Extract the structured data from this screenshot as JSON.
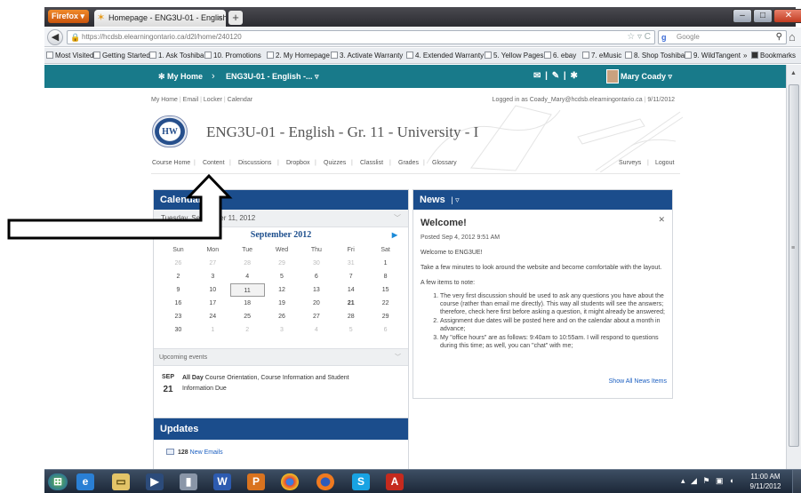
{
  "browser": {
    "firefox_button": "Firefox",
    "tab_title": "Homepage - ENG3U-01 - English - Gr. 11...",
    "url": "https://hcdsb.elearningontario.ca/d2l/home/240120",
    "search_placeholder": "Google"
  },
  "bookmarks": [
    "Most Visited",
    "Getting Started",
    "1. Ask Toshiba",
    "10. Promotions",
    "2. My Homepage",
    "3. Activate Warranty",
    "4. Extended Warranty",
    "5. Yellow Pages",
    "6. ebay",
    "7. eMusic",
    "8. Shop Toshiba",
    "9. WildTangent",
    "»",
    "Bookmarks"
  ],
  "d2l": {
    "my_home": "My Home",
    "course_crumb": "ENG3U-01 - English -...",
    "user": "Mary Coady"
  },
  "utility_nav": [
    "My Home",
    "Email",
    "Locker",
    "Calendar"
  ],
  "logged_in": "Logged in as Coady_Mary@hcdsb.elearningontario.ca",
  "date": "9/11/2012",
  "course_title": "ENG3U-01 - English - Gr. 11 - University - I",
  "logo_text": "HW",
  "course_nav": [
    "Course Home",
    "Content",
    "Discussions",
    "Dropbox",
    "Quizzes",
    "Classlist",
    "Grades",
    "Glossary"
  ],
  "course_nav_right": [
    "Surveys",
    "Logout"
  ],
  "calendar": {
    "title": "Calendar",
    "current_date": "Tuesday, September 11, 2012",
    "month": "September 2012",
    "weekdays": [
      "Sun",
      "Mon",
      "Tue",
      "Wed",
      "Thu",
      "Fri",
      "Sat"
    ],
    "weeks": [
      [
        "26",
        "27",
        "28",
        "29",
        "30",
        "31",
        "1"
      ],
      [
        "2",
        "3",
        "4",
        "5",
        "6",
        "7",
        "8"
      ],
      [
        "9",
        "10",
        "11",
        "12",
        "13",
        "14",
        "15"
      ],
      [
        "16",
        "17",
        "18",
        "19",
        "20",
        "21",
        "22"
      ],
      [
        "23",
        "24",
        "25",
        "26",
        "27",
        "28",
        "29"
      ],
      [
        "30",
        "1",
        "2",
        "3",
        "4",
        "5",
        "6"
      ]
    ],
    "today": "11",
    "upcoming_label": "Upcoming events",
    "event_month": "SEP",
    "event_day": "21",
    "event_when": "All Day",
    "event_text": "Course Orientation, Course Information and Student Information Due"
  },
  "news": {
    "title": "News",
    "item_title": "Welcome!",
    "posted": "Posted Sep 4, 2012 9:51 AM",
    "welcome": "Welcome to ENG3UE!",
    "intro": "Take a few minutes to look around the website and become comfortable with the layout.",
    "items_heading": "A few items to note:",
    "items": [
      "The very first discussion should be used to ask any questions you have about the course (rather than email me directly). This way all students will see the answers; therefore, check here first before asking a question, it might already be answered;",
      "Assignment due dates will be posted here and on the calendar about a month in advance;",
      "My \"office hours\" are as follows: 9:40am to 10:55am. I will respond to questions during this time; as well, you can \"chat\" with me;"
    ],
    "show_all": "Show All News Items"
  },
  "updates": {
    "title": "Updates",
    "count": "128",
    "link": "New Emails"
  },
  "taskbar": {
    "time": "11:00 AM",
    "date": "9/11/2012"
  },
  "colors": {
    "d2l_bar": "#187a8a",
    "widget_header": "#1b4d8c",
    "link": "#1a5ec0"
  }
}
